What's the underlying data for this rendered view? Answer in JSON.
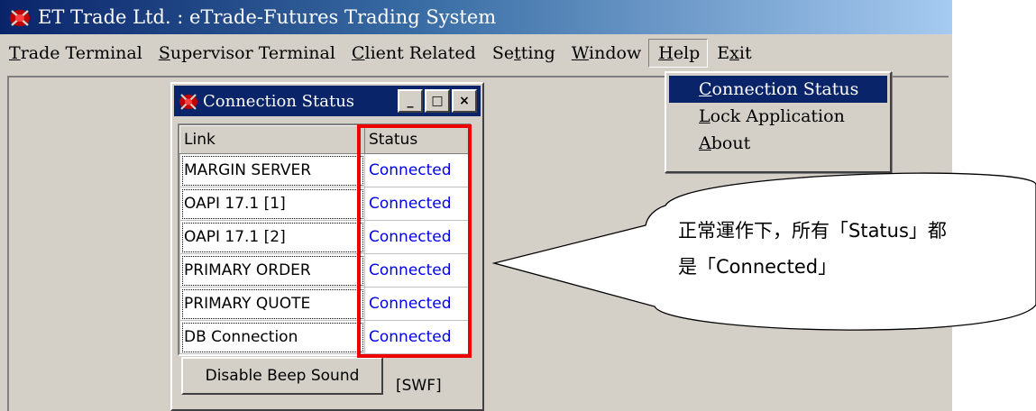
{
  "window": {
    "title": "ET Trade Ltd. : eTrade-Futures Trading System"
  },
  "menu": {
    "items": [
      {
        "label": "Trade Terminal",
        "key": "T",
        "rest": "rade Terminal"
      },
      {
        "label": "Supervisor Terminal",
        "key": "S",
        "rest": "upervisor Terminal"
      },
      {
        "label": "Client Related",
        "key": "C",
        "rest": "lient Related"
      },
      {
        "label": "Setting",
        "pre": "Se",
        "key": "t",
        "rest": "ting"
      },
      {
        "label": "Window",
        "key": "W",
        "rest": "indow"
      },
      {
        "label": "Help",
        "key": "H",
        "rest": "elp"
      },
      {
        "label": "Exit",
        "pre": "E",
        "key": "x",
        "rest": "it"
      }
    ]
  },
  "help_menu": {
    "items": [
      {
        "key": "C",
        "rest": "onnection Status"
      },
      {
        "key": "L",
        "rest": "ock Application"
      },
      {
        "key": "A",
        "rest": "bout"
      }
    ]
  },
  "connection_window": {
    "title": "Connection Status",
    "columns": [
      "Link",
      "Status"
    ],
    "rows": [
      {
        "link": "MARGIN SERVER",
        "status": "Connected"
      },
      {
        "link": "OAPI 17.1 [1]",
        "status": "Connected"
      },
      {
        "link": "OAPI 17.1 [2]",
        "status": "Connected"
      },
      {
        "link": "PRIMARY ORDER",
        "status": "Connected"
      },
      {
        "link": "PRIMARY QUOTE",
        "status": "Connected"
      },
      {
        "link": "DB Connection",
        "status": "Connected"
      }
    ],
    "beep_button": "Disable Beep Sound",
    "mode": "[SWF]",
    "buttons": {
      "minimize": "_",
      "maximize": "□",
      "close": "×"
    }
  },
  "callout": {
    "line1": "正常運作下，所有「Status」都",
    "line2": "是「Connected」"
  },
  "colors": {
    "titlebar": "#0a246a",
    "status_text": "#0000ee",
    "highlight_box": "#ee0000",
    "face": "#d4d0c8"
  },
  "icons": [
    "app-icon",
    "window-icon"
  ]
}
